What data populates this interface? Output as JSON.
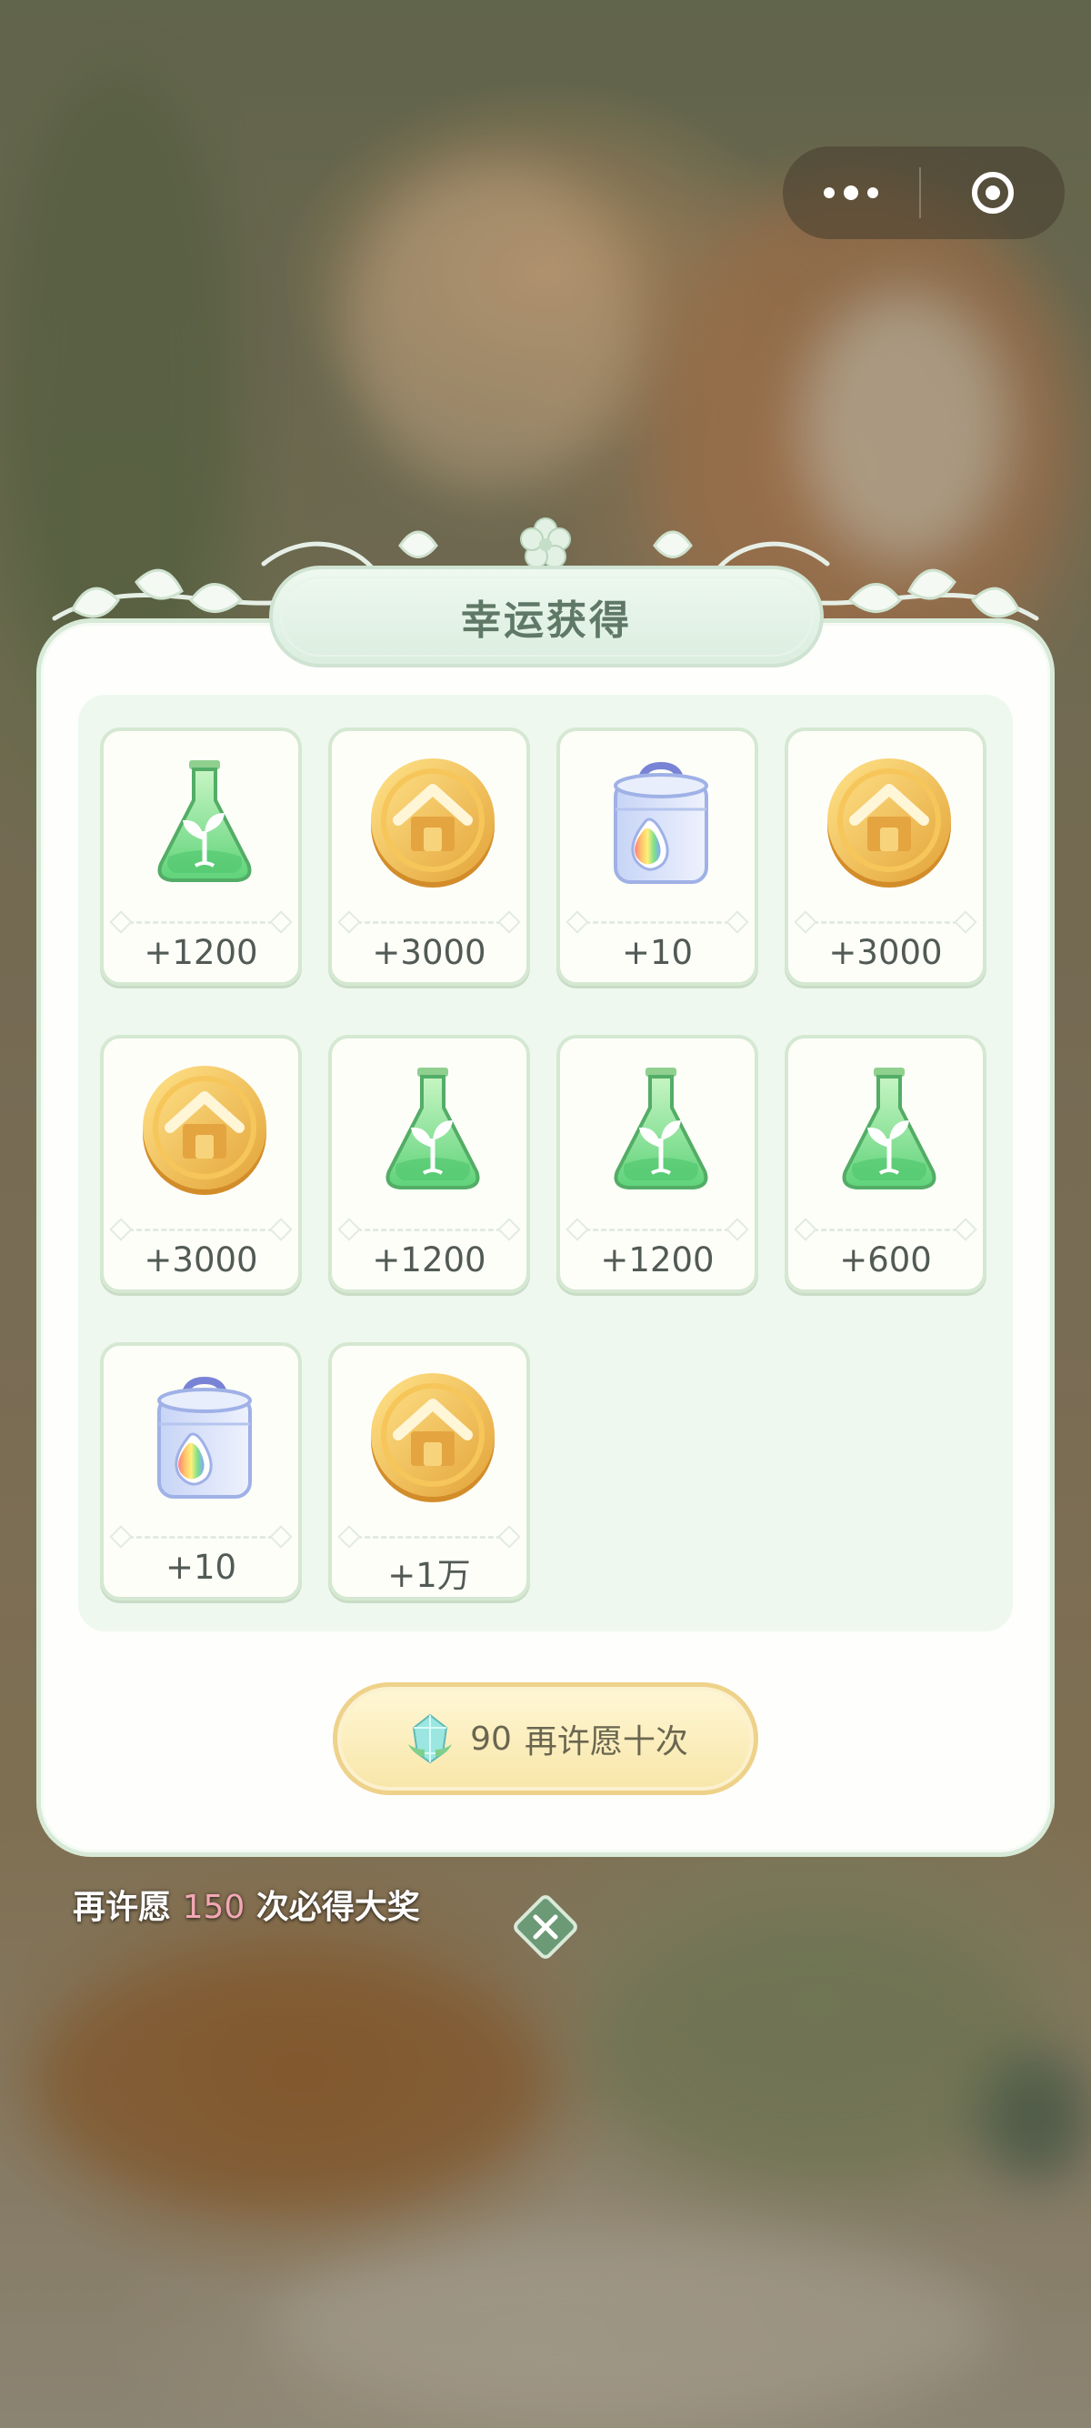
{
  "top_bar": {
    "menu_icon": "more-dots-icon",
    "target_icon": "target-icon"
  },
  "panel": {
    "title": "幸运获得",
    "rewards": [
      {
        "item": "green-potion-icon",
        "amount": "+1200"
      },
      {
        "item": "gold-coin-icon",
        "amount": "+3000"
      },
      {
        "item": "rainbow-bucket-icon",
        "amount": "+10"
      },
      {
        "item": "gold-coin-icon",
        "amount": "+3000"
      },
      {
        "item": "gold-coin-icon",
        "amount": "+3000"
      },
      {
        "item": "green-potion-icon",
        "amount": "+1200"
      },
      {
        "item": "green-potion-icon",
        "amount": "+1200"
      },
      {
        "item": "green-potion-icon",
        "amount": "+600"
      },
      {
        "item": "rainbow-bucket-icon",
        "amount": "+10"
      },
      {
        "item": "gold-coin-icon",
        "amount": "+1万"
      }
    ],
    "wish_button": {
      "cost": "90",
      "label": "再许愿十次",
      "icon": "crystal-gem-icon"
    }
  },
  "footer": {
    "prefix": "再许愿",
    "count": "150",
    "suffix": "次必得大奖",
    "close_icon": "close-icon"
  },
  "colors": {
    "accent_pink": "#f2a7b4",
    "panel_border": "#d7ead7",
    "button_gold": "#eed28a"
  }
}
